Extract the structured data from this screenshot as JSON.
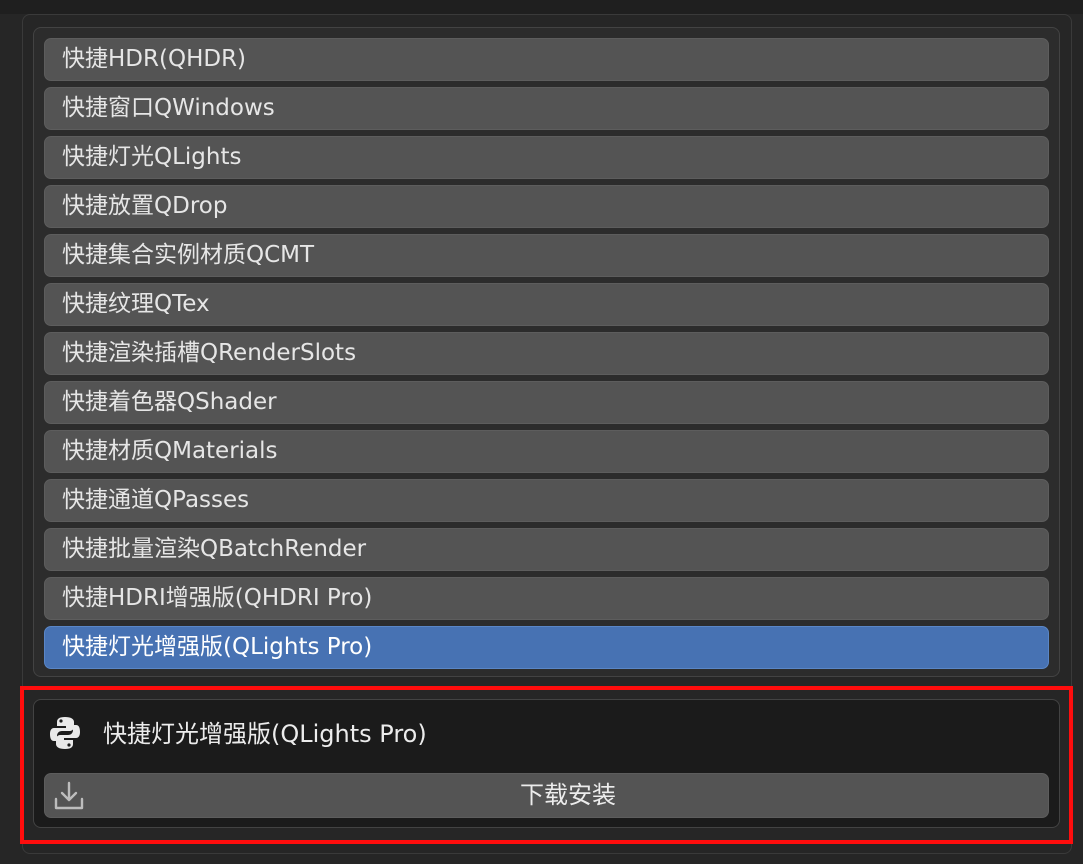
{
  "list": {
    "items": [
      {
        "label": "快捷HDR(QHDR)"
      },
      {
        "label": "快捷窗口QWindows"
      },
      {
        "label": "快捷灯光QLights"
      },
      {
        "label": "快捷放置QDrop"
      },
      {
        "label": "快捷集合实例材质QCMT"
      },
      {
        "label": "快捷纹理QTex"
      },
      {
        "label": "快捷渲染插槽QRenderSlots"
      },
      {
        "label": "快捷着色器QShader"
      },
      {
        "label": "快捷材质QMaterials"
      },
      {
        "label": "快捷通道QPasses"
      },
      {
        "label": "快捷批量渲染QBatchRender"
      },
      {
        "label": "快捷HDRI增强版(QHDRI Pro)"
      },
      {
        "label": "快捷灯光增强版(QLights Pro)"
      }
    ],
    "selected_label": "快捷灯光增强版(QLights Pro)"
  },
  "detail": {
    "icon": "python-icon",
    "title": "快捷灯光增强版(QLights Pro)",
    "download_icon": "download-icon",
    "download_label": "下载安装"
  },
  "colors": {
    "background": "#262626",
    "item": "#545454",
    "selected": "#4772b3",
    "highlight": "#ff0d0d"
  }
}
